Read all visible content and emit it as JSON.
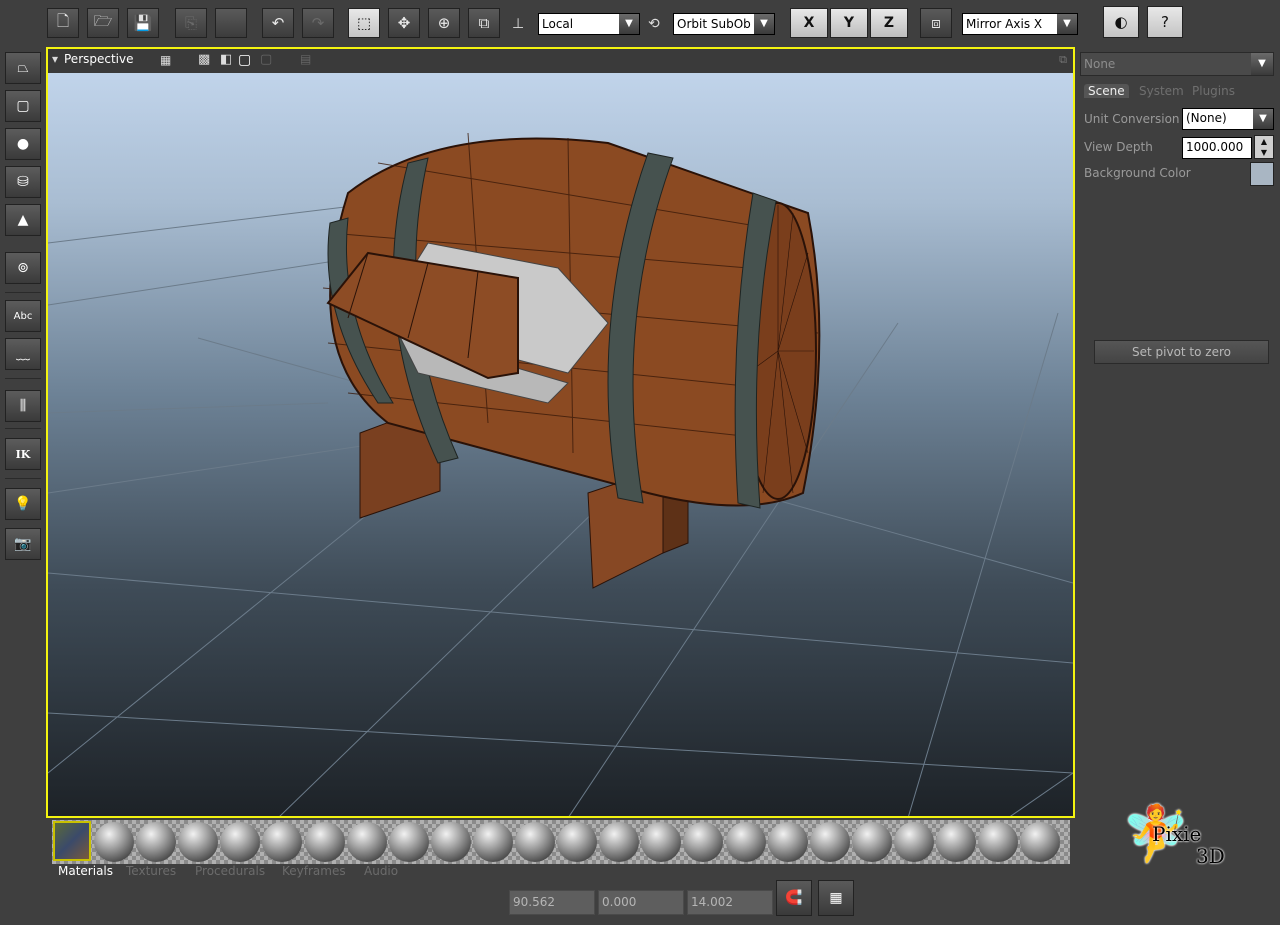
{
  "toolbar": {
    "coord_space": "Local",
    "orbit_mode": "Orbit SubOb",
    "axis_x": "X",
    "axis_y": "Y",
    "axis_z": "Z",
    "mirror_axis": "Mirror Axis X"
  },
  "viewport": {
    "title": "Perspective"
  },
  "left_tools": {
    "text_label": "Abc",
    "ik_label": "IK"
  },
  "right_panel": {
    "object_select": "None",
    "tabs": [
      "Scene",
      "System",
      "Plugins"
    ],
    "unit_conversion_label": "Unit Conversion",
    "unit_conversion_value": "(None)",
    "view_depth_label": "View Depth",
    "view_depth_value": "1000.000",
    "background_color_label": "Background Color",
    "background_color": "#a9b6c3",
    "set_pivot_label": "Set pivot to zero"
  },
  "bottom": {
    "tabs": [
      "Materials",
      "Textures",
      "Procedurals",
      "Keyframes",
      "Audio"
    ],
    "coord_x": "90.562",
    "coord_y": "0.000",
    "coord_z": "14.002"
  },
  "logo": {
    "name": "Pixie",
    "suffix": "3D"
  },
  "colors": {
    "viewport_border": "#f4f410",
    "wood": "#8b4a22",
    "hoop": "#46524f"
  }
}
